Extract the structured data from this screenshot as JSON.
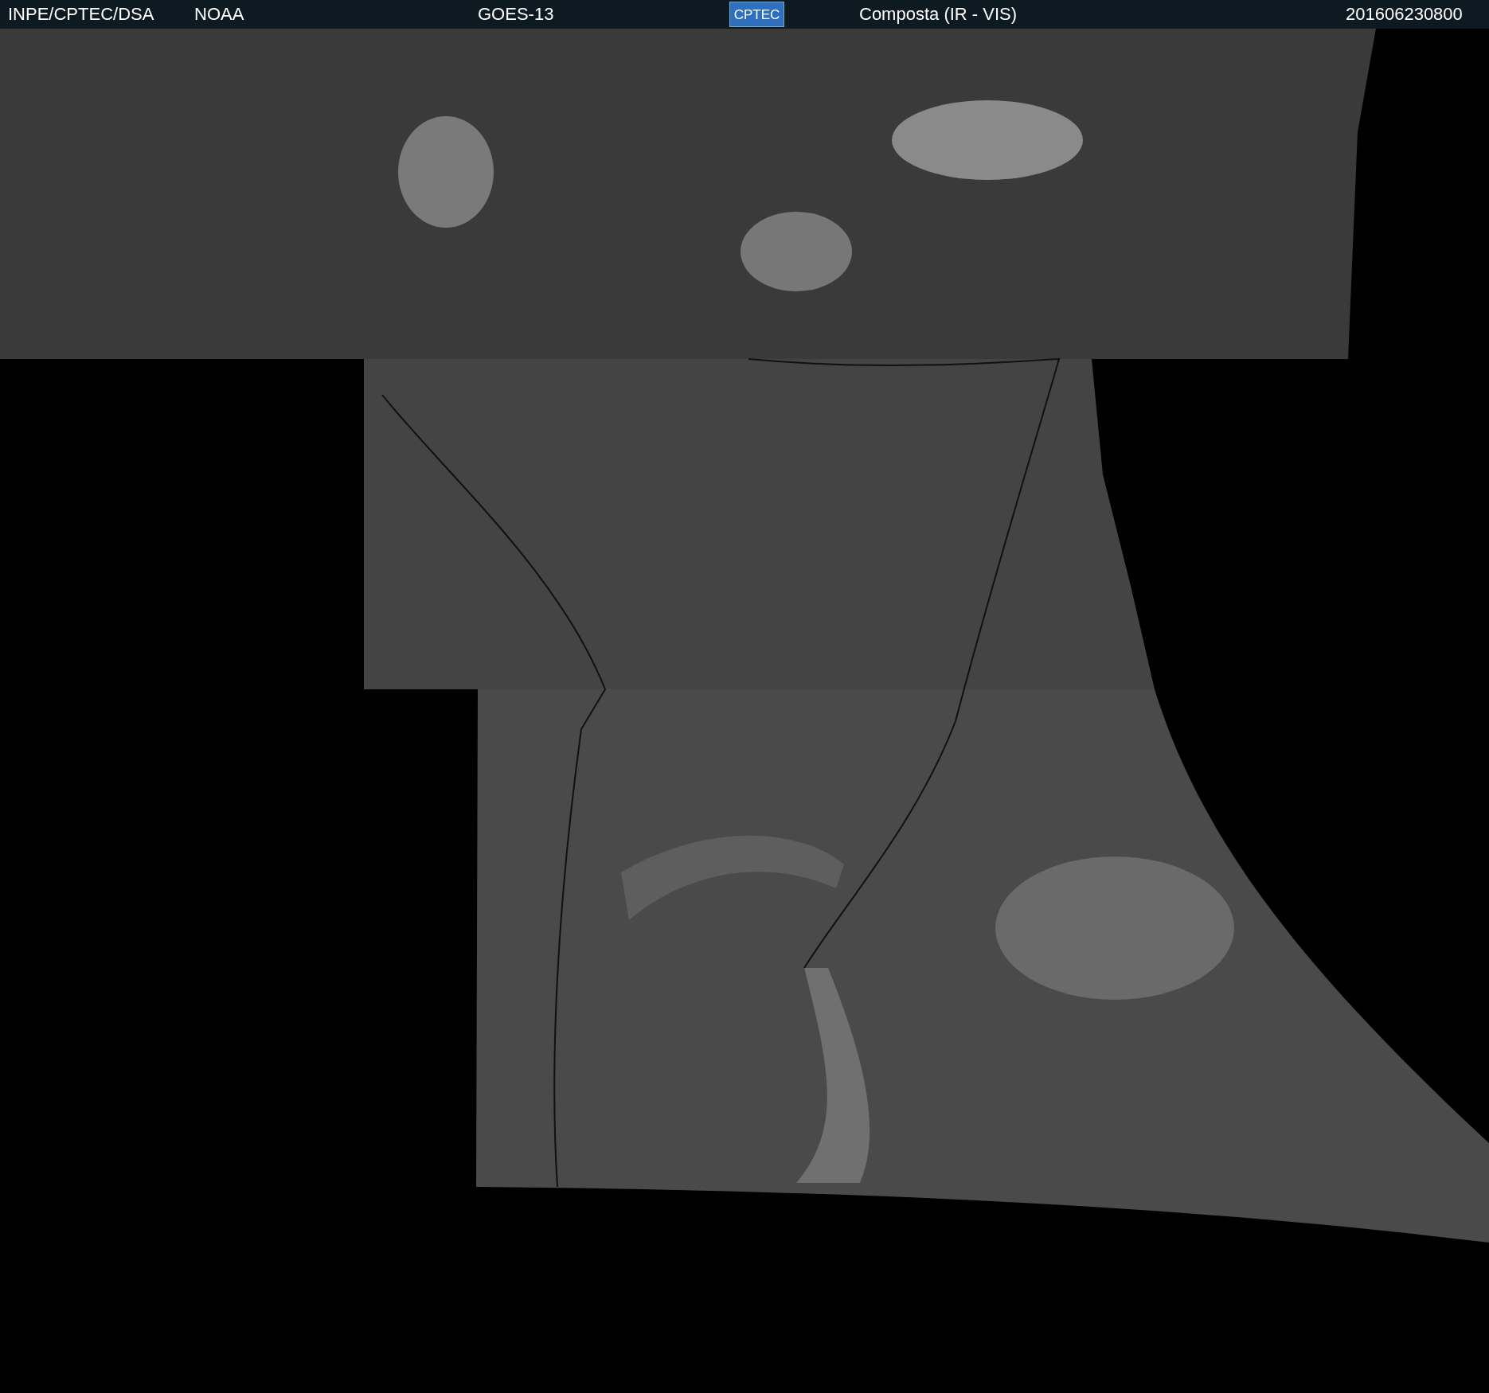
{
  "header": {
    "items": [
      {
        "kind": "text",
        "text": "INPE/CPTEC/DSA"
      },
      {
        "kind": "text",
        "text": "NOAA"
      },
      {
        "kind": "text",
        "text": "GOES-13"
      },
      {
        "kind": "logo",
        "text": "CPTEC"
      },
      {
        "kind": "text",
        "text": "Composta (IR - VIS)"
      },
      {
        "kind": "text",
        "text": "201606230800"
      }
    ]
  }
}
